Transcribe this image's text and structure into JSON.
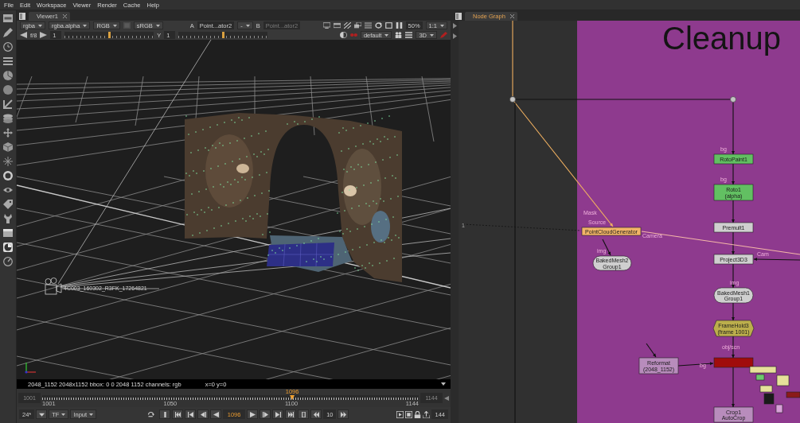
{
  "menu_bar": [
    "File",
    "Edit",
    "Workspace",
    "Viewer",
    "Render",
    "Cache",
    "Help"
  ],
  "viewer": {
    "tab": {
      "label": "Viewer1",
      "focused": false
    },
    "toolbar": [
      {
        "kind": "dropdown",
        "value": "rgba"
      },
      {
        "kind": "dropdown",
        "value": "rgba.alpha"
      },
      {
        "kind": "dropdown",
        "value": "RGB"
      },
      {
        "kind": "dropdown",
        "value": "sRGB"
      },
      {
        "kind": "input",
        "label": "A",
        "value": "Point...ator2",
        "disabled": false
      },
      {
        "kind": "dropdown",
        "value": "-"
      },
      {
        "kind": "input",
        "label": "B",
        "value": "Point...ator2",
        "disabled": true
      }
    ],
    "zoom": "50%",
    "proxy": "1:1",
    "exposure": {
      "label": "f/8",
      "value": "1",
      "level": 0.5
    },
    "gamma": {
      "label": "Y",
      "value": "1",
      "level": 0.5
    },
    "lut": "default",
    "view_mode": "3D",
    "camera_label": "4C003_160302_R3FK_17264821",
    "info": {
      "format": "2048_1152 2048x1152 bbox: 0 0 2048 1152 channels: rgb",
      "coords": "x=0 y=0"
    }
  },
  "timeline": {
    "first": "1001",
    "last": "1144",
    "current": "1096",
    "level": 0.664,
    "ticks": [
      "1001",
      "1050",
      "1100",
      "1144"
    ]
  },
  "playback": {
    "fps": "24*",
    "mode": "TF",
    "source": "Input",
    "frame": "1096",
    "increment": "10",
    "end": "144"
  },
  "node_graph": {
    "tab": {
      "label": "Node Graph",
      "focused": true
    },
    "backdrop": {
      "label": "Cleanup",
      "color": "#8e3a8e"
    },
    "nodes": [
      {
        "kind": "rect",
        "label": "RotoPaint1",
        "color": "#62c062"
      },
      {
        "kind": "rect",
        "label": "Roto1",
        "sublabel": "(alpha)",
        "color": "#62c062"
      },
      {
        "kind": "rect",
        "label": "PointCloudGenerator",
        "color": "#f2b468"
      },
      {
        "kind": "rect",
        "label": "Premult1",
        "color": "#cfcfcf"
      },
      {
        "kind": "rounded",
        "label": "BakedMesh2",
        "sublabel": "Group1",
        "color": "#cfcfcf"
      },
      {
        "kind": "rect",
        "label": "Project3D3",
        "color": "#cfcfcf"
      },
      {
        "kind": "rounded",
        "label": "BakedMesh1",
        "sublabel": "Group1",
        "color": "#cfcfcf"
      },
      {
        "kind": "hexagon",
        "label": "FrameHold3",
        "sublabel": "(frame 1001)",
        "color": "#bcae4c"
      },
      {
        "kind": "rect",
        "label": "Reformat",
        "sublabel": "(2048_1152)",
        "color": "#b88cbc"
      },
      {
        "kind": "rect",
        "color": "#a00c0c"
      },
      {
        "kind": "rect",
        "label": "Crop1",
        "sublabel": "AutoCrop",
        "color": "#b88cbc"
      },
      {
        "kind": "mini",
        "color": "#e6e09a"
      },
      {
        "kind": "mini",
        "color": "#6ec86e"
      },
      {
        "kind": "mini",
        "color": "#e6e09a"
      },
      {
        "kind": "mini",
        "color": "#e6e09a"
      },
      {
        "kind": "mini",
        "color": "#1a1a1a"
      },
      {
        "kind": "mini",
        "color": "#8a1a1a"
      },
      {
        "kind": "mini",
        "color": "#d8a0d8"
      }
    ],
    "input_labels": [
      "bg",
      "bg",
      "Mask",
      "Source",
      "Camera",
      "img",
      "Cam",
      "img",
      "obj/scn",
      "bg",
      "1"
    ]
  }
}
